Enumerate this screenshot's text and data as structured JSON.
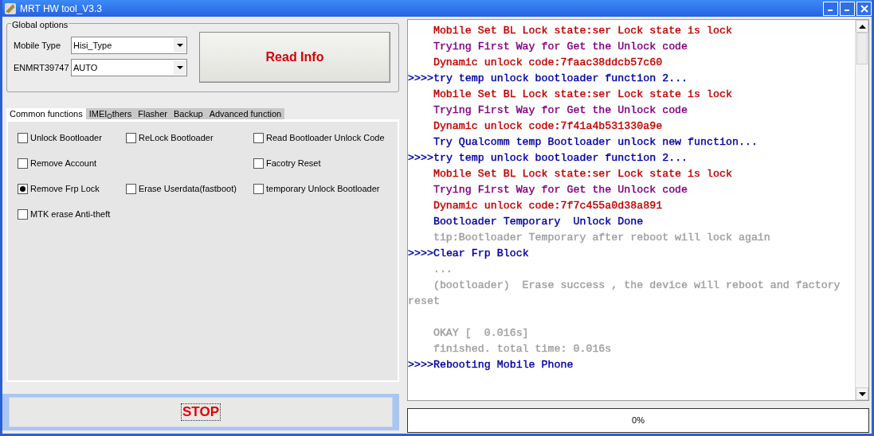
{
  "window": {
    "title": "MRT HW tool_V3.3"
  },
  "global_options": {
    "title": "Global options",
    "fields": [
      {
        "label": "Mobile Type",
        "value": "Hisi_Type"
      },
      {
        "label": "ENMRT39747",
        "value": "AUTO"
      }
    ],
    "read_button": "Read Info"
  },
  "tabs": [
    {
      "label": "Common functions",
      "selected": true
    },
    {
      "label": "IMEI$_{O}$thers",
      "selected": false
    },
    {
      "label": "Flasher",
      "selected": false
    },
    {
      "label": "Backup",
      "selected": false
    },
    {
      "label": "Advanced function",
      "selected": false
    }
  ],
  "option_rows": [
    [
      {
        "label": "Unlock Bootloader",
        "checked": false
      },
      {
        "label": "ReLock Bootloader",
        "checked": false
      },
      {
        "label": "Read Bootloader Unlock Code",
        "checked": false
      }
    ],
    [
      {
        "label": "Remove Account",
        "checked": false
      },
      null,
      {
        "label": "Facotry Reset",
        "checked": false
      }
    ],
    [
      {
        "label": "Remove Frp Lock",
        "checked": true
      },
      {
        "label": "Erase Userdata(fastboot)",
        "checked": false
      },
      {
        "label": "temporary Unlock Bootloader",
        "checked": false
      }
    ],
    [
      {
        "label": "MTK erase Anti-theft",
        "checked": false
      },
      null,
      null
    ]
  ],
  "stop_button": "STOP",
  "log": [
    {
      "kind": "info",
      "text": "Mobile Set BL Lock state:ser Lock state is lock",
      "color": "#c00000"
    },
    {
      "kind": "info",
      "text": "Trying First Way for Get the Unlock code",
      "color": "#800080"
    },
    {
      "kind": "info",
      "text": "Dynamic unlock code:7faac38ddcb57c60",
      "color": "#c00000"
    },
    {
      "kind": "step",
      "text": ">>>>try temp unlock bootloader function 2...",
      "color": "#0000a0"
    },
    {
      "kind": "info",
      "text": "Mobile Set BL Lock state:ser Lock state is lock",
      "color": "#c00000"
    },
    {
      "kind": "info",
      "text": "Trying First Way for Get the Unlock code",
      "color": "#800080"
    },
    {
      "kind": "info",
      "text": "Dynamic unlock code:7f41a4b531330a9e",
      "color": "#c00000"
    },
    {
      "kind": "info",
      "text": "Try Qualcomm temp Bootloader unlock new function...",
      "color": "#0000a0"
    },
    {
      "kind": "step",
      "text": ">>>>try temp unlock bootloader function 2...",
      "color": "#0000a0"
    },
    {
      "kind": "info",
      "text": "Mobile Set BL Lock state:ser Lock state is lock",
      "color": "#c00000"
    },
    {
      "kind": "info",
      "text": "Trying First Way for Get the Unlock code",
      "color": "#800080"
    },
    {
      "kind": "info",
      "text": "Dynamic unlock code:7f7c455a0d38a891",
      "color": "#c00000"
    },
    {
      "kind": "info",
      "text": "Bootloader Temporary  Unlock Done",
      "color": "#0000a0"
    },
    {
      "kind": "info",
      "text": "tip:Bootloader Temporary after reboot will lock again",
      "color": "#a0a0a0"
    },
    {
      "kind": "step",
      "text": ">>>>Clear Frp Block",
      "color": "#0000a0"
    },
    {
      "kind": "info",
      "text": "...",
      "color": "#a0a0a0"
    },
    {
      "kind": "info",
      "text": "(bootloader)  Erase success , the device will reboot and factory reset",
      "color": "#a0a0a0"
    },
    {
      "kind": "blank"
    },
    {
      "kind": "info",
      "text": "OKAY [  0.016s]",
      "color": "#a0a0a0"
    },
    {
      "kind": "info",
      "text": "finished. total time: 0.016s",
      "color": "#a0a0a0"
    },
    {
      "kind": "step",
      "text": ">>>>Rebooting Mobile Phone",
      "color": "#0000a0"
    }
  ],
  "progress": {
    "text": "0%",
    "level": 0
  }
}
